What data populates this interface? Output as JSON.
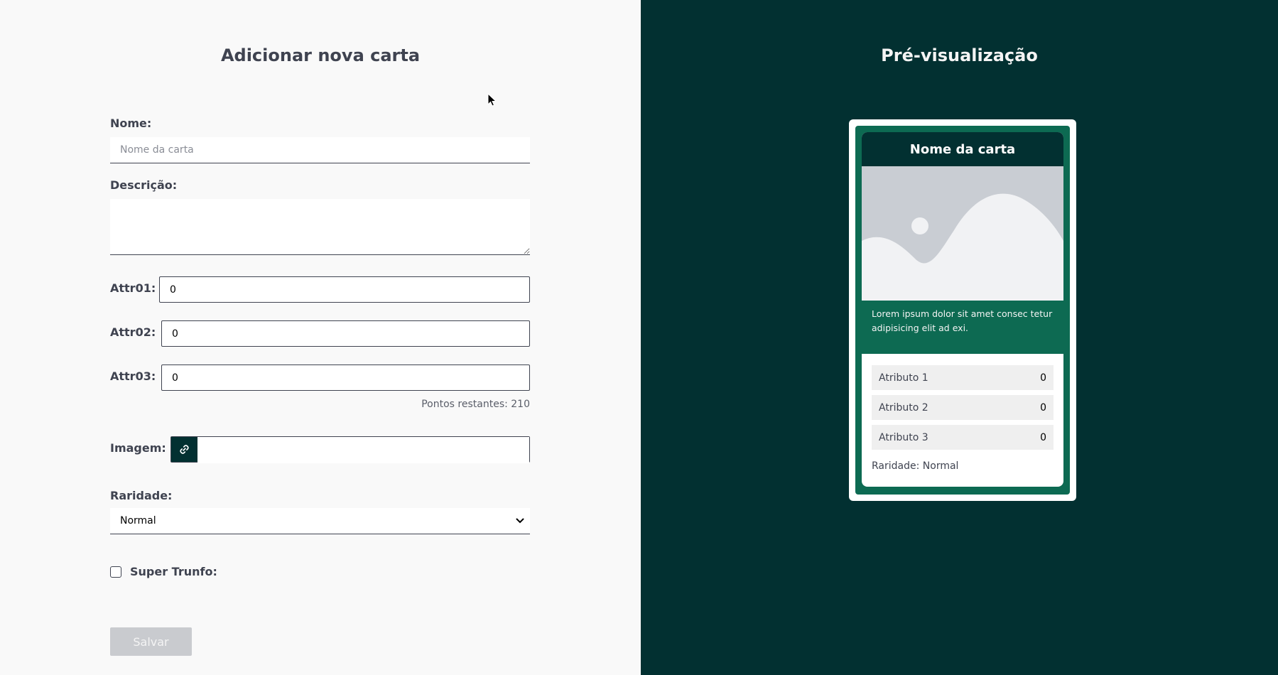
{
  "form": {
    "title": "Adicionar nova carta",
    "name_label": "Nome:",
    "name_placeholder": "Nome da carta",
    "name_value": "",
    "description_label": "Descrição:",
    "description_value": "",
    "attr1_label": "Attr01:",
    "attr1_value": "0",
    "attr2_label": "Attr02:",
    "attr2_value": "0",
    "attr3_label": "Attr03:",
    "attr3_value": "0",
    "points_remaining": "Pontos restantes: 210",
    "image_label": "Imagem:",
    "image_value": "",
    "rarity_label": "Raridade:",
    "rarity_selected": "Normal",
    "super_trunfo_label": "Super Trunfo:",
    "super_trunfo_checked": false,
    "save_label": "Salvar"
  },
  "preview": {
    "title": "Pré-visualização",
    "card_name": "Nome da carta",
    "card_description": "Lorem ipsum dolor sit amet consec tetur adipisicing elit ad exi.",
    "attributes": [
      {
        "label": "Atributo 1",
        "value": "0"
      },
      {
        "label": "Atributo 2",
        "value": "0"
      },
      {
        "label": "Atributo 3",
        "value": "0"
      }
    ],
    "rarity_text": "Raridade: Normal"
  },
  "colors": {
    "left_bg": "#f9f9f9",
    "right_bg": "#023031",
    "card_green": "#0d6a52",
    "text_dark": "#3f4350"
  }
}
